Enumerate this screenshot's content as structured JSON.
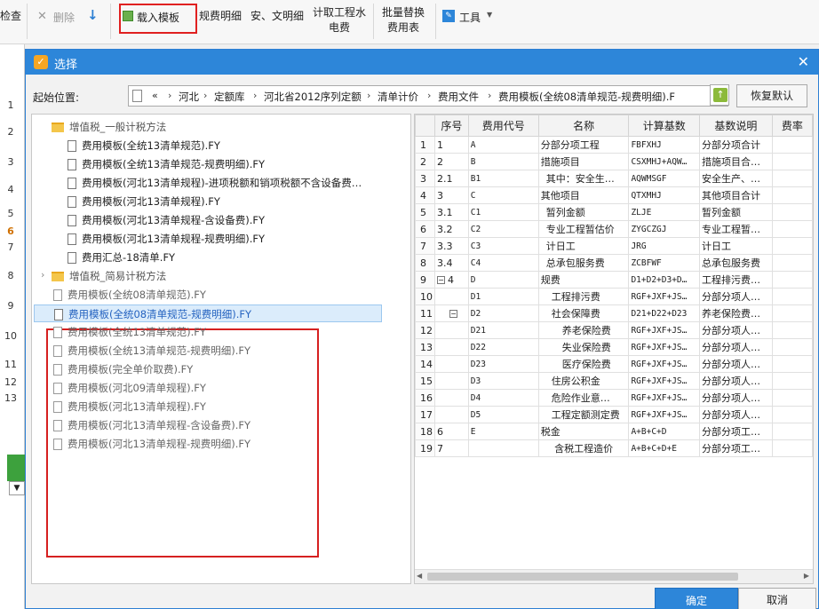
{
  "toolbar": {
    "check": "检查",
    "delete": "删除",
    "load_template": "载入模板",
    "fee_detail": "规费明细",
    "safe_civil_detail": "安、文明细",
    "calc_water_elec_1": "计取工程水",
    "calc_water_elec_2": "电费",
    "batch_replace_1": "批量替换",
    "batch_replace_2": "费用表",
    "tools": "工具",
    "colors": {
      "highlight_border": "#e02020"
    }
  },
  "background": {
    "row_numbers": [
      "1",
      "2",
      "3",
      "4",
      "5",
      "6",
      "7",
      "8",
      "9",
      "10",
      "11",
      "12",
      "13"
    ],
    "highlighted_row": "6"
  },
  "dialog": {
    "title": "选择",
    "start_label": "起始位置:",
    "path": {
      "back": "«",
      "crumbs": [
        "河北",
        "定额库",
        "河北省2012序列定额",
        "清单计价",
        "费用文件",
        "费用模板(全统08清单规范-规费明细).F"
      ],
      "separator": "›"
    },
    "reset_button": "恢复默认",
    "ok_button": "确定",
    "cancel_button": "取消",
    "colors": {
      "title_bar": "#2d86d9",
      "selection": "#2563c0",
      "red_box": "#d62020"
    }
  },
  "tree": {
    "groups": [
      {
        "name": "增值税_一般计税方法",
        "files": [
          "费用模板(全统13清单规范).FY",
          "费用模板(全统13清单规范-规费明细).FY",
          "费用模板(河北13清单规程)-进项税额和销项税额不含设备费…",
          "费用模板(河北13清单规程).FY",
          "费用模板(河北13清单规程-含设备费).FY",
          "费用模板(河北13清单规程-规费明细).FY",
          "费用汇总-18清单.FY"
        ]
      },
      {
        "name": "增值税_简易计税方法",
        "files": [
          "费用模板(全统08清单规范).FY",
          "费用模板(全统08清单规范-规费明细).FY",
          "费用模板(全统13清单规范).FY",
          "费用模板(全统13清单规范-规费明细).FY",
          "费用模板(完全单价取费).FY",
          "费用模板(河北09清单规程).FY",
          "费用模板(河北13清单规程).FY",
          "费用模板(河北13清单规程-含设备费).FY",
          "费用模板(河北13清单规程-规费明细).FY"
        ],
        "selected_index": 1
      }
    ]
  },
  "grid": {
    "headers": [
      "",
      "序号",
      "费用代号",
      "名称",
      "计算基数",
      "基数说明",
      "费率"
    ],
    "rows": [
      {
        "n": "1",
        "seq": "1",
        "code": "A",
        "name": "分部分项工程",
        "base": "FBFXHJ",
        "desc": "分部分项合计"
      },
      {
        "n": "2",
        "seq": "2",
        "code": "B",
        "name": "措施项目",
        "base": "CSXMHJ+AQW…",
        "desc": "措施项目合…"
      },
      {
        "n": "3",
        "seq": "2.1",
        "code": "B1",
        "name": "其中：安全生…",
        "base": "AQWMSGF",
        "desc": "安全生产、…"
      },
      {
        "n": "4",
        "seq": "3",
        "code": "C",
        "name": "其他项目",
        "base": "QTXMHJ",
        "desc": "其他项目合计"
      },
      {
        "n": "5",
        "seq": "3.1",
        "code": "C1",
        "name": "暂列金额",
        "base": "ZLJE",
        "desc": "暂列金额"
      },
      {
        "n": "6",
        "seq": "3.2",
        "code": "C2",
        "name": "专业工程暂估价",
        "base": "ZYGCZGJ",
        "desc": "专业工程暂…"
      },
      {
        "n": "7",
        "seq": "3.3",
        "code": "C3",
        "name": "计日工",
        "base": "JRG",
        "desc": "计日工"
      },
      {
        "n": "8",
        "seq": "3.4",
        "code": "C4",
        "name": "总承包服务费",
        "base": "ZCBFWF",
        "desc": "总承包服务费"
      },
      {
        "n": "9",
        "seq": "4",
        "code": "D",
        "name": "规费",
        "base": "D1+D2+D3+D…",
        "desc": "工程排污费…"
      },
      {
        "n": "10",
        "seq": "",
        "code": "D1",
        "name": "工程排污费",
        "base": "RGF+JXF+JS…",
        "desc": "分部分项人…"
      },
      {
        "n": "11",
        "seq": "",
        "code": "D2",
        "name": "社会保障费",
        "base": "D21+D22+D23",
        "desc": "养老保险费…"
      },
      {
        "n": "12",
        "seq": "",
        "code": "D21",
        "name": "养老保险费",
        "base": "RGF+JXF+JS…",
        "desc": "分部分项人…"
      },
      {
        "n": "13",
        "seq": "",
        "code": "D22",
        "name": "失业保险费",
        "base": "RGF+JXF+JS…",
        "desc": "分部分项人…"
      },
      {
        "n": "14",
        "seq": "",
        "code": "D23",
        "name": "医疗保险费",
        "base": "RGF+JXF+JS…",
        "desc": "分部分项人…"
      },
      {
        "n": "15",
        "seq": "",
        "code": "D3",
        "name": "住房公积金",
        "base": "RGF+JXF+JS…",
        "desc": "分部分项人…"
      },
      {
        "n": "16",
        "seq": "",
        "code": "D4",
        "name": "危险作业意…",
        "base": "RGF+JXF+JS…",
        "desc": "分部分项人…"
      },
      {
        "n": "17",
        "seq": "",
        "code": "D5",
        "name": "工程定额测定费",
        "base": "RGF+JXF+JS…",
        "desc": "分部分项人…"
      },
      {
        "n": "18",
        "seq": "6",
        "code": "E",
        "name": "税金",
        "base": "A+B+C+D",
        "desc": "分部分项工…"
      },
      {
        "n": "19",
        "seq": "7",
        "code": "",
        "name": "含税工程造价",
        "base": "A+B+C+D+E",
        "desc": "分部分项工…"
      }
    ]
  }
}
